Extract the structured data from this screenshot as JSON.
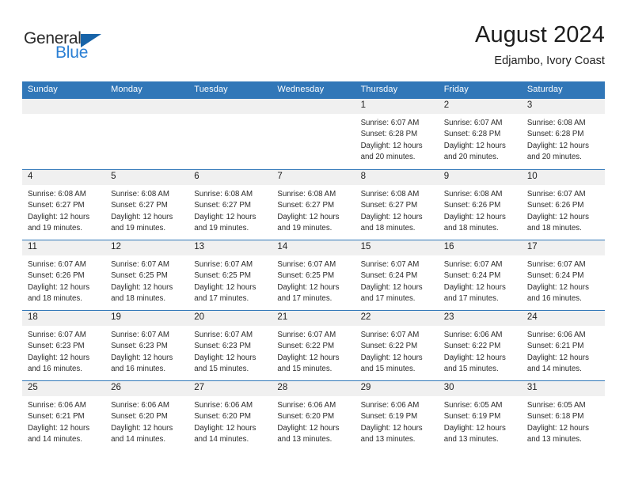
{
  "brand": {
    "word1": "General",
    "word2": "Blue",
    "triangle_color": "#1763a8",
    "word2_color": "#2a7fd4"
  },
  "header": {
    "title": "August 2024",
    "subtitle": "Edjambo, Ivory Coast"
  },
  "theme": {
    "header_blue": "#3177b8",
    "day_band_gray": "#f0f0f0",
    "text": "#2b2b2b"
  },
  "weekdays": [
    "Sunday",
    "Monday",
    "Tuesday",
    "Wednesday",
    "Thursday",
    "Friday",
    "Saturday"
  ],
  "weeks": [
    [
      {
        "day": "",
        "sunrise": "",
        "sunset": "",
        "daylight1": "",
        "daylight2": ""
      },
      {
        "day": "",
        "sunrise": "",
        "sunset": "",
        "daylight1": "",
        "daylight2": ""
      },
      {
        "day": "",
        "sunrise": "",
        "sunset": "",
        "daylight1": "",
        "daylight2": ""
      },
      {
        "day": "",
        "sunrise": "",
        "sunset": "",
        "daylight1": "",
        "daylight2": ""
      },
      {
        "day": "1",
        "sunrise": "Sunrise: 6:07 AM",
        "sunset": "Sunset: 6:28 PM",
        "daylight1": "Daylight: 12 hours",
        "daylight2": "and 20 minutes."
      },
      {
        "day": "2",
        "sunrise": "Sunrise: 6:07 AM",
        "sunset": "Sunset: 6:28 PM",
        "daylight1": "Daylight: 12 hours",
        "daylight2": "and 20 minutes."
      },
      {
        "day": "3",
        "sunrise": "Sunrise: 6:08 AM",
        "sunset": "Sunset: 6:28 PM",
        "daylight1": "Daylight: 12 hours",
        "daylight2": "and 20 minutes."
      }
    ],
    [
      {
        "day": "4",
        "sunrise": "Sunrise: 6:08 AM",
        "sunset": "Sunset: 6:27 PM",
        "daylight1": "Daylight: 12 hours",
        "daylight2": "and 19 minutes."
      },
      {
        "day": "5",
        "sunrise": "Sunrise: 6:08 AM",
        "sunset": "Sunset: 6:27 PM",
        "daylight1": "Daylight: 12 hours",
        "daylight2": "and 19 minutes."
      },
      {
        "day": "6",
        "sunrise": "Sunrise: 6:08 AM",
        "sunset": "Sunset: 6:27 PM",
        "daylight1": "Daylight: 12 hours",
        "daylight2": "and 19 minutes."
      },
      {
        "day": "7",
        "sunrise": "Sunrise: 6:08 AM",
        "sunset": "Sunset: 6:27 PM",
        "daylight1": "Daylight: 12 hours",
        "daylight2": "and 19 minutes."
      },
      {
        "day": "8",
        "sunrise": "Sunrise: 6:08 AM",
        "sunset": "Sunset: 6:27 PM",
        "daylight1": "Daylight: 12 hours",
        "daylight2": "and 18 minutes."
      },
      {
        "day": "9",
        "sunrise": "Sunrise: 6:08 AM",
        "sunset": "Sunset: 6:26 PM",
        "daylight1": "Daylight: 12 hours",
        "daylight2": "and 18 minutes."
      },
      {
        "day": "10",
        "sunrise": "Sunrise: 6:07 AM",
        "sunset": "Sunset: 6:26 PM",
        "daylight1": "Daylight: 12 hours",
        "daylight2": "and 18 minutes."
      }
    ],
    [
      {
        "day": "11",
        "sunrise": "Sunrise: 6:07 AM",
        "sunset": "Sunset: 6:26 PM",
        "daylight1": "Daylight: 12 hours",
        "daylight2": "and 18 minutes."
      },
      {
        "day": "12",
        "sunrise": "Sunrise: 6:07 AM",
        "sunset": "Sunset: 6:25 PM",
        "daylight1": "Daylight: 12 hours",
        "daylight2": "and 18 minutes."
      },
      {
        "day": "13",
        "sunrise": "Sunrise: 6:07 AM",
        "sunset": "Sunset: 6:25 PM",
        "daylight1": "Daylight: 12 hours",
        "daylight2": "and 17 minutes."
      },
      {
        "day": "14",
        "sunrise": "Sunrise: 6:07 AM",
        "sunset": "Sunset: 6:25 PM",
        "daylight1": "Daylight: 12 hours",
        "daylight2": "and 17 minutes."
      },
      {
        "day": "15",
        "sunrise": "Sunrise: 6:07 AM",
        "sunset": "Sunset: 6:24 PM",
        "daylight1": "Daylight: 12 hours",
        "daylight2": "and 17 minutes."
      },
      {
        "day": "16",
        "sunrise": "Sunrise: 6:07 AM",
        "sunset": "Sunset: 6:24 PM",
        "daylight1": "Daylight: 12 hours",
        "daylight2": "and 17 minutes."
      },
      {
        "day": "17",
        "sunrise": "Sunrise: 6:07 AM",
        "sunset": "Sunset: 6:24 PM",
        "daylight1": "Daylight: 12 hours",
        "daylight2": "and 16 minutes."
      }
    ],
    [
      {
        "day": "18",
        "sunrise": "Sunrise: 6:07 AM",
        "sunset": "Sunset: 6:23 PM",
        "daylight1": "Daylight: 12 hours",
        "daylight2": "and 16 minutes."
      },
      {
        "day": "19",
        "sunrise": "Sunrise: 6:07 AM",
        "sunset": "Sunset: 6:23 PM",
        "daylight1": "Daylight: 12 hours",
        "daylight2": "and 16 minutes."
      },
      {
        "day": "20",
        "sunrise": "Sunrise: 6:07 AM",
        "sunset": "Sunset: 6:23 PM",
        "daylight1": "Daylight: 12 hours",
        "daylight2": "and 15 minutes."
      },
      {
        "day": "21",
        "sunrise": "Sunrise: 6:07 AM",
        "sunset": "Sunset: 6:22 PM",
        "daylight1": "Daylight: 12 hours",
        "daylight2": "and 15 minutes."
      },
      {
        "day": "22",
        "sunrise": "Sunrise: 6:07 AM",
        "sunset": "Sunset: 6:22 PM",
        "daylight1": "Daylight: 12 hours",
        "daylight2": "and 15 minutes."
      },
      {
        "day": "23",
        "sunrise": "Sunrise: 6:06 AM",
        "sunset": "Sunset: 6:22 PM",
        "daylight1": "Daylight: 12 hours",
        "daylight2": "and 15 minutes."
      },
      {
        "day": "24",
        "sunrise": "Sunrise: 6:06 AM",
        "sunset": "Sunset: 6:21 PM",
        "daylight1": "Daylight: 12 hours",
        "daylight2": "and 14 minutes."
      }
    ],
    [
      {
        "day": "25",
        "sunrise": "Sunrise: 6:06 AM",
        "sunset": "Sunset: 6:21 PM",
        "daylight1": "Daylight: 12 hours",
        "daylight2": "and 14 minutes."
      },
      {
        "day": "26",
        "sunrise": "Sunrise: 6:06 AM",
        "sunset": "Sunset: 6:20 PM",
        "daylight1": "Daylight: 12 hours",
        "daylight2": "and 14 minutes."
      },
      {
        "day": "27",
        "sunrise": "Sunrise: 6:06 AM",
        "sunset": "Sunset: 6:20 PM",
        "daylight1": "Daylight: 12 hours",
        "daylight2": "and 14 minutes."
      },
      {
        "day": "28",
        "sunrise": "Sunrise: 6:06 AM",
        "sunset": "Sunset: 6:20 PM",
        "daylight1": "Daylight: 12 hours",
        "daylight2": "and 13 minutes."
      },
      {
        "day": "29",
        "sunrise": "Sunrise: 6:06 AM",
        "sunset": "Sunset: 6:19 PM",
        "daylight1": "Daylight: 12 hours",
        "daylight2": "and 13 minutes."
      },
      {
        "day": "30",
        "sunrise": "Sunrise: 6:05 AM",
        "sunset": "Sunset: 6:19 PM",
        "daylight1": "Daylight: 12 hours",
        "daylight2": "and 13 minutes."
      },
      {
        "day": "31",
        "sunrise": "Sunrise: 6:05 AM",
        "sunset": "Sunset: 6:18 PM",
        "daylight1": "Daylight: 12 hours",
        "daylight2": "and 13 minutes."
      }
    ]
  ]
}
